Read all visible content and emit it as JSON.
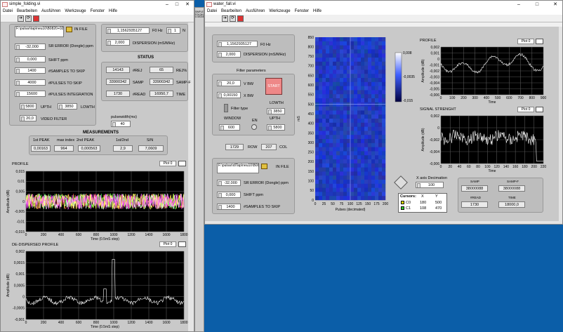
{
  "left_window": {
    "title": "simple_folding.vi",
    "menu": [
      "Datei",
      "Bearbeiten",
      "Ausführen",
      "Werkzeuge",
      "Fenster",
      "Hilfe"
    ],
    "file_path": "F:\\pulsar\\tap\\neu10\\B0820+02_2020mar05_0620.fil",
    "fields": [
      {
        "label": "SR ERROR (Dongle) ppm",
        "value": "-32,000"
      },
      {
        "label": "SHIFT ppm",
        "value": "0,000"
      },
      {
        "label": "#SAMPLES TO SKIP",
        "value": "1400"
      },
      {
        "label": "#PULSES TO SKIP",
        "value": "4000"
      },
      {
        "label": "#PULSES INTEGRATION",
        "value": "15600"
      }
    ],
    "upth": {
      "label": "UPTH",
      "value": "5800"
    },
    "lowth": {
      "label": "LOWTH",
      "value": "3850"
    },
    "video_filter": {
      "label": "VIDEO FILTER",
      "value": "20,0"
    },
    "f0": {
      "label": "F0 Hz",
      "value": "1,1562935127"
    },
    "n": {
      "label": "N",
      "value": "1"
    },
    "dispersion": {
      "label": "DISPERSION (mS/MHz)",
      "value": "2,000"
    },
    "status": {
      "title": "STATUS",
      "rej": "14143",
      "rej_label": "#REJ",
      "rej_pct": "65",
      "rej_pct_label": "REJ%",
      "samp": "33900342",
      "samp_label": "SAMP",
      "samp_f": "33900342",
      "samp_f_label": "SAMP-F",
      "read": "1730",
      "read_label": "#READ",
      "time": "16950,7",
      "time_label": "TIME"
    },
    "pulsewidth": {
      "label": "pulsewidth(ms)",
      "value": "40"
    },
    "measurements": {
      "title": "MEASUREMENTS",
      "headers": [
        "1st PEAK",
        "max index",
        "2nd PEAK",
        "1st/2nd",
        "S/N"
      ],
      "values": [
        "0,00163",
        "964",
        "0,000563",
        "2,9",
        "7,0609"
      ]
    },
    "profile": {
      "title": "PROFILE",
      "plot": "Plot 0",
      "ylabel": "Amplitude (dB)",
      "xlabel": "Time (0.5mS step)",
      "yticks": [
        "0,015",
        "0,01",
        "0,005",
        "0",
        "-0,005",
        "-0,01",
        "-0,015"
      ],
      "xticks": [
        "0",
        "200",
        "400",
        "600",
        "800",
        "1000",
        "1200",
        "1400",
        "1600",
        "1800"
      ]
    },
    "dedispersed": {
      "title": "DE-DISPERSED PROFILE",
      "plot": "Plot 0",
      "ylabel": "Amplitude (dB)",
      "xlabel": "Time (0.5mS step)",
      "yticks": [
        "0,002",
        "0,0015",
        "0,001",
        "0,0005",
        "0",
        "-0,0005",
        "-0,001"
      ],
      "xticks": [
        "0",
        "200",
        "400",
        "600",
        "800",
        "1000",
        "1200",
        "1400",
        "1600",
        "1800"
      ]
    }
  },
  "right_window": {
    "title": "water_fall.vi",
    "menu": [
      "Datei",
      "Bearbeiten",
      "Ausführen",
      "Werkzeuge",
      "Fenster",
      "Hilfe"
    ],
    "f0": {
      "label": "F0 Hz",
      "value": "1,1562935127"
    },
    "dispersion": {
      "label": "DISPERSION (mS/MHz)",
      "value": "2,000"
    },
    "filter_params": "Filter parameters",
    "vbw": {
      "label": "V BW",
      "value": "20,0"
    },
    "xbw": {
      "label": "X BW",
      "value": "0,00150"
    },
    "start": "START",
    "filter_type": "Filter type",
    "lowth": {
      "label": "LOWTH",
      "value": "3850"
    },
    "upth": {
      "label": "UPTH",
      "value": "5800"
    },
    "window": {
      "label": "WINDOW",
      "value": "600"
    },
    "en": "EN",
    "row": {
      "value": "1729",
      "label": "ROW"
    },
    "col": {
      "value": "207",
      "label": "COL"
    },
    "in_file": {
      "label": "IN FILE",
      "value": "F:\\pulsar\\dlTap\\neu10\\B0820+"
    },
    "sr_error": {
      "label": "SR ERROR (Dongle) ppm",
      "value": "-32,000"
    },
    "shift": {
      "label": "SHIFT ppm",
      "value": "0,000"
    },
    "samples_skip": {
      "label": "#SAMPLES TO SKIP",
      "value": "1400"
    },
    "waterfall": {
      "ylabel": "mS",
      "xlabel": "Pulses (decimated)",
      "yticks": [
        "850",
        "800",
        "750",
        "700",
        "650",
        "600",
        "550",
        "500",
        "450",
        "400",
        "350",
        "300",
        "250",
        "200",
        "150",
        "100",
        "50",
        "0"
      ],
      "xticks": [
        "0",
        "25",
        "50",
        "75",
        "100",
        "125",
        "150",
        "175",
        "200"
      ]
    },
    "colorbar": [
      "0,008",
      "-0,0035",
      "-0,015"
    ],
    "profile": {
      "title": "PROFILE",
      "plot": "Plot 0",
      "ylabel": "Amplitude (dB)",
      "xlabel": "Time",
      "yticks": [
        "0,002",
        "0,001",
        "0",
        "-0,001",
        "-0,002",
        "-0,003",
        "-0,004",
        "-0,005",
        "-0,006"
      ],
      "xticks": [
        "0",
        "100",
        "200",
        "300",
        "400",
        "500",
        "600",
        "700",
        "800",
        "900"
      ]
    },
    "signal": {
      "title": "SIGNAL STRENGHT",
      "plot": "Plot 0",
      "ylabel": "Amplitude (dB)",
      "xlabel": "Time",
      "yticks": [
        "0,002",
        "0",
        "-0,002",
        "-0,004",
        "-0,006"
      ],
      "xticks": [
        "0",
        "20",
        "40",
        "60",
        "80",
        "100",
        "120",
        "140",
        "160",
        "180",
        "200",
        "220"
      ]
    },
    "x_decimation": {
      "label": "X axis Decimation",
      "value": "100"
    },
    "cursors": {
      "headers": [
        "Cursors:",
        "X",
        "Y"
      ],
      "rows": [
        [
          "C0",
          "180",
          "500"
        ],
        [
          "C1",
          "108",
          "470"
        ]
      ]
    },
    "mini_status": {
      "samp": "38000088",
      "samp_label": "SAMP",
      "samp_f": "38000088",
      "samp_f_label": "SAMP-F",
      "read": "1730",
      "read_label": "#READ",
      "time": "18000,0",
      "time_label": "TIME"
    }
  },
  "mini_window": {
    "title": "SIMPLE FOLDING MODE"
  }
}
